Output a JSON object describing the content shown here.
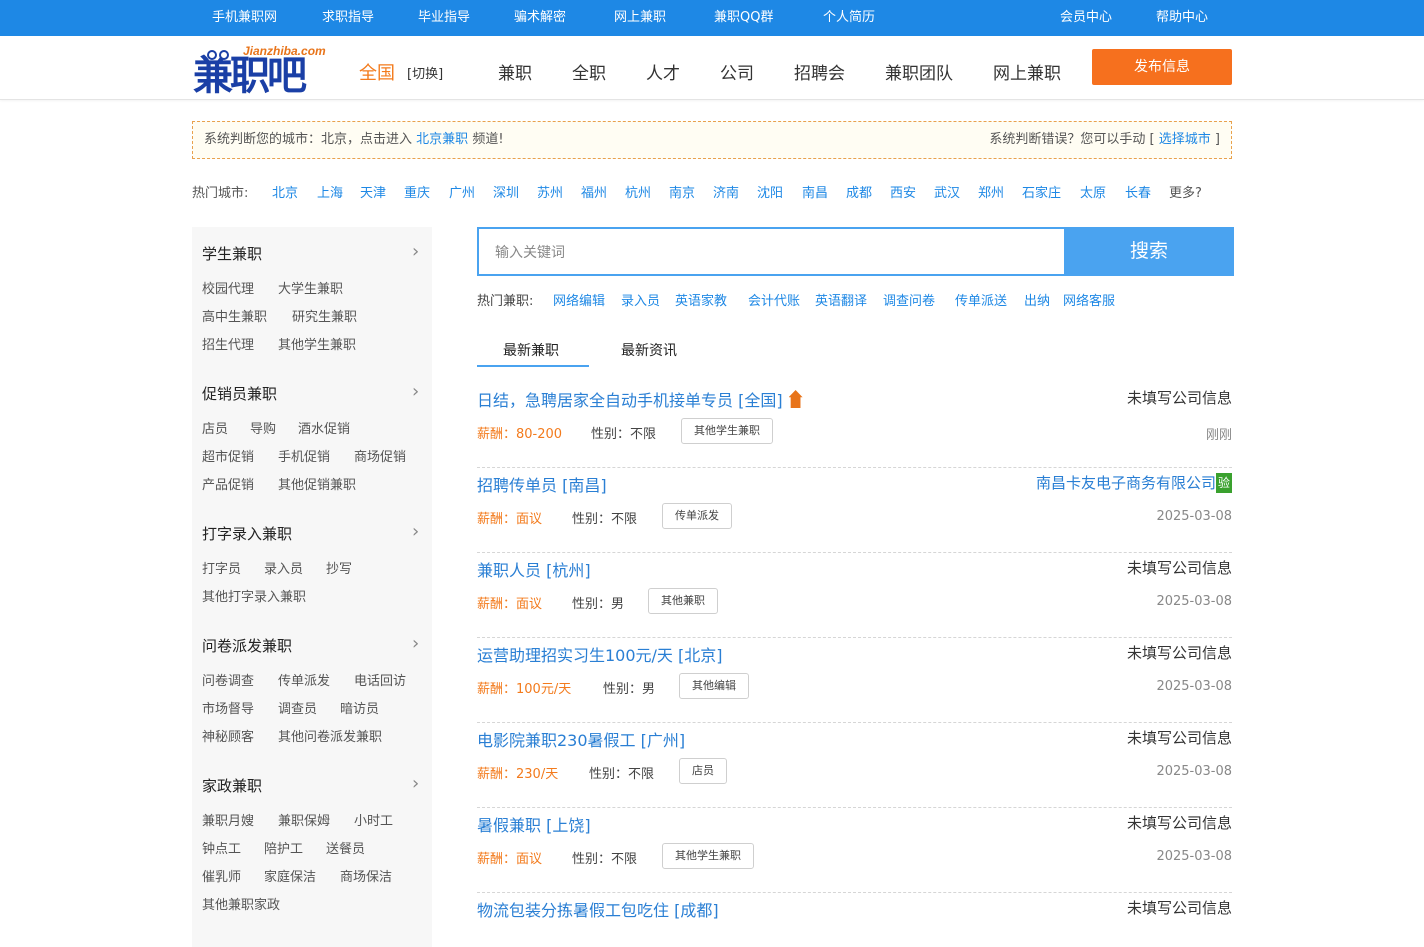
{
  "topbar": {
    "left_items": [
      "手机兼职网",
      "求职指导",
      "毕业指导",
      "骗术解密",
      "网上兼职",
      "兼职QQ群",
      "个人简历"
    ],
    "right_items": [
      "会员中心",
      "帮助中心"
    ]
  },
  "header": {
    "logo_domain": "Jianzhiba.com",
    "logo_text": "兼职吧",
    "region": "全国",
    "switch": "[切换]",
    "nav": [
      "兼职",
      "全职",
      "人才",
      "公司",
      "招聘会",
      "兼职团队",
      "网上兼职"
    ],
    "post_button": "发布信息"
  },
  "notice": {
    "prefix": "系统判断您的城市：北京，点击进入",
    "city_link": "北京兼职",
    "suffix": "频道!",
    "right_prefix": "系统判断错误？您可以手动 [",
    "right_link": "选择城市",
    "right_suffix": "]"
  },
  "hot_cities": {
    "label": "热门城市:",
    "cities": [
      "北京",
      "上海",
      "天津",
      "重庆",
      "广州",
      "深圳",
      "苏州",
      "福州",
      "杭州",
      "南京",
      "济南",
      "沈阳",
      "南昌",
      "成都",
      "西安",
      "武汉",
      "郑州",
      "石家庄",
      "太原",
      "长春"
    ],
    "more": "更多?"
  },
  "sidebar": {
    "categories": [
      {
        "title": "学生兼职",
        "items": [
          "校园代理",
          "大学生兼职",
          "高中生兼职",
          "研究生兼职",
          "招生代理",
          "其他学生兼职"
        ]
      },
      {
        "title": "促销员兼职",
        "items": [
          "店员",
          "导购",
          "酒水促销",
          "超市促销",
          "手机促销",
          "商场促销",
          "产品促销",
          "其他促销兼职"
        ]
      },
      {
        "title": "打字录入兼职",
        "items": [
          "打字员",
          "录入员",
          "抄写",
          "其他打字录入兼职"
        ]
      },
      {
        "title": "问卷派发兼职",
        "items": [
          "问卷调查",
          "传单派发",
          "电话回访",
          "市场督导",
          "调查员",
          "暗访员",
          "神秘顾客",
          "其他问卷派发兼职"
        ]
      },
      {
        "title": "家政兼职",
        "items": [
          "兼职月嫂",
          "兼职保姆",
          "小时工",
          "钟点工",
          "陪护工",
          "送餐员",
          "催乳师",
          "家庭保洁",
          "商场保洁",
          "其他兼职家政"
        ]
      }
    ]
  },
  "search": {
    "placeholder": "输入关键词",
    "button": "搜索"
  },
  "hot_jobs": {
    "label": "热门兼职:",
    "keywords": [
      "网络编辑",
      "录入员",
      "英语家教",
      "会计代账",
      "英语翻译",
      "调查问卷",
      "传单派送",
      "出纳",
      "网络客服"
    ]
  },
  "tabs": [
    "最新兼职",
    "最新资讯"
  ],
  "jobs": [
    {
      "title": "日结，急聘居家全自动手机接单专员 [全国]",
      "company": "未填写公司信息",
      "salary_label": "薪酬：",
      "salary": "80-200",
      "gender": "性别：不限",
      "tag": "其他学生兼职",
      "date": "刚刚",
      "top": true
    },
    {
      "title": "招聘传单员 [南昌]",
      "company": "南昌卡友电子商务有限公司",
      "verified": "验",
      "salary_label": "薪酬：",
      "salary": "面议",
      "gender": "性别：不限",
      "tag": "传单派发",
      "date": "2025-03-08"
    },
    {
      "title": "兼职人员 [杭州]",
      "company": "未填写公司信息",
      "salary_label": "薪酬：",
      "salary": "面议",
      "gender": "性别：男",
      "tag": "其他兼职",
      "date": "2025-03-08"
    },
    {
      "title": "运营助理招实习生100元/天 [北京]",
      "company": "未填写公司信息",
      "salary_label": "薪酬：",
      "salary": "100元/天",
      "gender": "性别：男",
      "tag": "其他编辑",
      "date": "2025-03-08"
    },
    {
      "title": "电影院兼职230暑假工 [广州]",
      "company": "未填写公司信息",
      "salary_label": "薪酬：",
      "salary": "230/天",
      "gender": "性别：不限",
      "tag": "店员",
      "date": "2025-03-08"
    },
    {
      "title": "暑假兼职 [上饶]",
      "company": "未填写公司信息",
      "salary_label": "薪酬：",
      "salary": "面议",
      "gender": "性别：不限",
      "tag": "其他学生兼职",
      "date": "2025-03-08"
    },
    {
      "title": "物流包装分拣暑假工包吃住 [成都]",
      "company": "未填写公司信息",
      "salary_label": "薪酬：",
      "salary": "",
      "gender": "",
      "tag": "",
      "date": ""
    }
  ]
}
